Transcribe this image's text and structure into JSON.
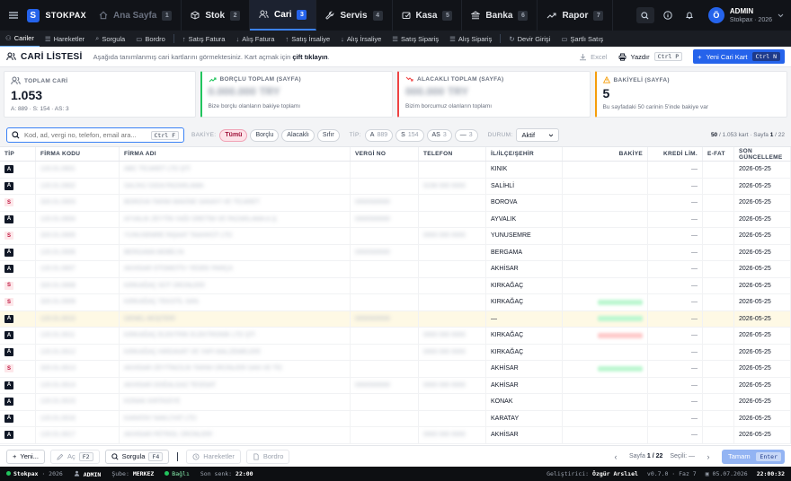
{
  "app": {
    "name": "STOKPAX",
    "logo_letter": "S"
  },
  "modules": [
    {
      "label": "Ana Sayfa",
      "key": "1",
      "icon": "home-icon",
      "dim": true
    },
    {
      "label": "Stok",
      "key": "2",
      "icon": "box-icon"
    },
    {
      "label": "Cari",
      "key": "3",
      "icon": "users-icon",
      "active": true
    },
    {
      "label": "Servis",
      "key": "4",
      "icon": "wrench-icon"
    },
    {
      "label": "Kasa",
      "key": "5",
      "icon": "cash-icon"
    },
    {
      "label": "Banka",
      "key": "6",
      "icon": "bank-icon"
    },
    {
      "label": "Rapor",
      "key": "7",
      "icon": "chart-icon"
    }
  ],
  "user": {
    "initial": "Ö",
    "name": "ADMIN",
    "sub": "Stokpax · 2026"
  },
  "subnav": [
    "Cariler",
    "Hareketler",
    "Sorgula",
    "Bordro",
    "Satış Fatura",
    "Alış Fatura",
    "Satış İrsaliye",
    "Alış İrsaliye",
    "Satış Sipariş",
    "Alış Sipariş",
    "Devir Girişi",
    "Şartlı Satış"
  ],
  "page": {
    "title": "CARİ LİSTESİ",
    "desc": "Aşağıda tanımlanmış cari kartlarını görmektesiniz. Kart açmak için",
    "desc_bold": "çift tıklayın",
    "desc_end": ".",
    "excel": "Excel",
    "print": "Yazdır",
    "print_key": "Ctrl P",
    "new": "Yeni Cari Kart",
    "new_key": "Ctrl N"
  },
  "cards": [
    {
      "label": "TOPLAM CARİ",
      "value": "1.053",
      "sub": "A: 889 · S: 154 · AS: 3",
      "color": "#e5e7eb",
      "icon": "users-icon"
    },
    {
      "label": "BORÇLU TOPLAM (SAYFA)",
      "value": "0.000.000 TRY",
      "sub": "Bize borçlu olanların bakiye toplamı",
      "color": "#22c55e",
      "icon": "trend-up-icon"
    },
    {
      "label": "ALACAKLI TOPLAM (SAYFA)",
      "value": "000.000 TRY",
      "sub": "Bizim borcumuz olanların toplamı",
      "color": "#ef4444",
      "icon": "trend-down-icon"
    },
    {
      "label": "BAKİYELİ (SAYFA)",
      "value": "5",
      "sub": "Bu sayfadaki 50 carinin 5'inde bakiye var",
      "color": "#f59e0b",
      "icon": "warning-icon"
    }
  ],
  "filters": {
    "placeholder": "Kod, ad, vergi no, telefon, email ara...",
    "search_key": "Ctrl F",
    "bakiye_label": "BAKİYE:",
    "bakiye_opts": [
      "Tümü",
      "Borçlu",
      "Alacaklı",
      "Sıfır"
    ],
    "tip_label": "TİP:",
    "tip_opts": [
      {
        "l": "A",
        "n": "889"
      },
      {
        "l": "S",
        "n": "154"
      },
      {
        "l": "AS",
        "n": "3"
      },
      {
        "l": "—",
        "n": "3"
      }
    ],
    "durum_label": "DURUM:",
    "durum_value": "Aktif",
    "page_info_count": "50",
    "page_info_rest": "/ 1.053 kart · Sayfa",
    "page_cur": "1",
    "page_total": "/ 22"
  },
  "columns": [
    "TİP",
    "FİRMA KODU",
    "FİRMA ADI",
    "VERGİ NO",
    "TELEFON",
    "İL/İLÇE/ŞEHİR",
    "BAKİYE",
    "KREDİ LİM.",
    "E-FAT",
    "SON GÜNCELLEME"
  ],
  "rows": [
    {
      "tip": "A",
      "code": "120.01.0001",
      "name": "ABC TİCARET LTD ŞTİ",
      "vergi": "",
      "tel": "",
      "il": "KINIK",
      "bal": "",
      "kredi": "—",
      "efat": "",
      "date": "2026-05-25"
    },
    {
      "tip": "A",
      "code": "120.01.0002",
      "name": "SALİHLİ GIDA PAZARLAMA",
      "vergi": "",
      "tel": "0236 000 0000",
      "il": "SALİHLİ",
      "bal": "",
      "kredi": "—",
      "efat": "",
      "date": "2026-05-25"
    },
    {
      "tip": "S",
      "code": "320.01.0003",
      "name": "BOROVA TARIM MAKİNE SANAYİ VE TİCARET",
      "vergi": "0000000000",
      "tel": "",
      "il": "BOROVA",
      "bal": "",
      "kredi": "—",
      "efat": "",
      "date": "2026-05-25"
    },
    {
      "tip": "A",
      "code": "120.01.0004",
      "name": "AYVALIK ZEYTİN YAĞI ÜRETİM VE PAZARLAMA A.Ş.",
      "vergi": "0000000000",
      "tel": "",
      "il": "AYVALIK",
      "bal": "",
      "kredi": "—",
      "efat": "",
      "date": "2026-05-25"
    },
    {
      "tip": "S",
      "code": "320.01.0005",
      "name": "YUNUSEMRE İNŞAAT TAAHHÜT LTD",
      "vergi": "",
      "tel": "0000 000 0000",
      "il": "YUNUSEMRE",
      "bal": "",
      "kredi": "—",
      "efat": "",
      "date": "2026-05-25"
    },
    {
      "tip": "A",
      "code": "120.01.0006",
      "name": "BERGAMA MOBİLYA",
      "vergi": "0000000000",
      "tel": "",
      "il": "BERGAMA",
      "bal": "",
      "kredi": "—",
      "efat": "",
      "date": "2026-05-25"
    },
    {
      "tip": "A",
      "code": "120.01.0007",
      "name": "AKHİSAR OTOMOTİV YEDEK PARÇA",
      "vergi": "",
      "tel": "",
      "il": "AKHİSAR",
      "bal": "",
      "kredi": "—",
      "efat": "",
      "date": "2026-05-25"
    },
    {
      "tip": "S",
      "code": "320.01.0008",
      "name": "KIRKAĞAÇ SÜT ÜRÜNLERİ",
      "vergi": "",
      "tel": "",
      "il": "KIRKAĞAÇ",
      "bal": "",
      "kredi": "—",
      "efat": "",
      "date": "2026-05-25"
    },
    {
      "tip": "S",
      "code": "320.01.0009",
      "name": "KIRKAĞAÇ TEKSTİL SAN.",
      "vergi": "",
      "tel": "",
      "il": "KIRKAĞAÇ",
      "bal": "g",
      "kredi": "—",
      "efat": "",
      "date": "2026-05-25"
    },
    {
      "tip": "A",
      "code": "120.01.0010",
      "name": "GENEL MÜŞTERİ",
      "vergi": "0000000000",
      "tel": "",
      "il": "—",
      "bal": "g",
      "kredi": "—",
      "efat": "",
      "date": "2026-05-25",
      "hl": true
    },
    {
      "tip": "A",
      "code": "120.01.0011",
      "name": "KIRKAĞAÇ ELEKTRİK ELEKTRONİK LTD ŞTİ",
      "vergi": "",
      "tel": "0000 000 0000",
      "il": "KIRKAĞAÇ",
      "bal": "r",
      "kredi": "—",
      "efat": "",
      "date": "2026-05-25"
    },
    {
      "tip": "A",
      "code": "120.01.0012",
      "name": "KIRKAĞAÇ HIRDAVAT VE YAPI MALZEMELERİ",
      "vergi": "",
      "tel": "0000 000 0000",
      "il": "KIRKAĞAÇ",
      "bal": "",
      "kredi": "—",
      "efat": "",
      "date": "2026-05-25"
    },
    {
      "tip": "S",
      "code": "320.01.0013",
      "name": "AKHİSAR ZEYTİNCİLİK TARIM ÜRÜNLERİ SAN VE TİC",
      "vergi": "",
      "tel": "",
      "il": "AKHİSAR",
      "bal": "g",
      "kredi": "—",
      "efat": "",
      "date": "2026-05-25"
    },
    {
      "tip": "A",
      "code": "120.01.0014",
      "name": "AKHİSAR DOĞALGAZ TESİSAT",
      "vergi": "0000000000",
      "tel": "0000 000 0000",
      "il": "AKHİSAR",
      "bal": "",
      "kredi": "—",
      "efat": "",
      "date": "2026-05-25"
    },
    {
      "tip": "A",
      "code": "120.01.0015",
      "name": "KONAK KIRTASİYE",
      "vergi": "",
      "tel": "",
      "il": "KONAK",
      "bal": "",
      "kredi": "—",
      "efat": "",
      "date": "2026-05-25"
    },
    {
      "tip": "A",
      "code": "120.01.0016",
      "name": "KARATAY NAKLİYAT LTD",
      "vergi": "",
      "tel": "",
      "il": "KARATAY",
      "bal": "",
      "kredi": "—",
      "efat": "",
      "date": "2026-05-25"
    },
    {
      "tip": "A",
      "code": "120.01.0017",
      "name": "AKHİSAR PETROL ÜRÜNLERİ",
      "vergi": "",
      "tel": "0000 000 0000",
      "il": "AKHİSAR",
      "bal": "",
      "kredi": "—",
      "efat": "",
      "date": "2026-05-25"
    }
  ],
  "footer": {
    "new": "Yeni...",
    "open": "Aç",
    "open_key": "F2",
    "query": "Sorgula",
    "query_key": "F4",
    "moves": "Hareketler",
    "bordro": "Bordro",
    "page_label": "Sayfa",
    "page_cur": "1",
    "page_total": "/ 22",
    "selected": "Seçili: —",
    "ok": "Tamam",
    "ok_key": "Enter"
  },
  "status": {
    "app": "Stokpax",
    "year": "· 2026",
    "user": "ADMIN",
    "sube_label": "Şube:",
    "sube": "MERKEZ",
    "conn": "Bağlı",
    "sync_label": "Son senk:",
    "sync": "22:00",
    "dev_label": "Geliştirici:",
    "dev": "Özgür Arslıel",
    "version": "v0.7.0 · Faz 7",
    "date": "05.07.2026",
    "time": "22:00:32"
  }
}
